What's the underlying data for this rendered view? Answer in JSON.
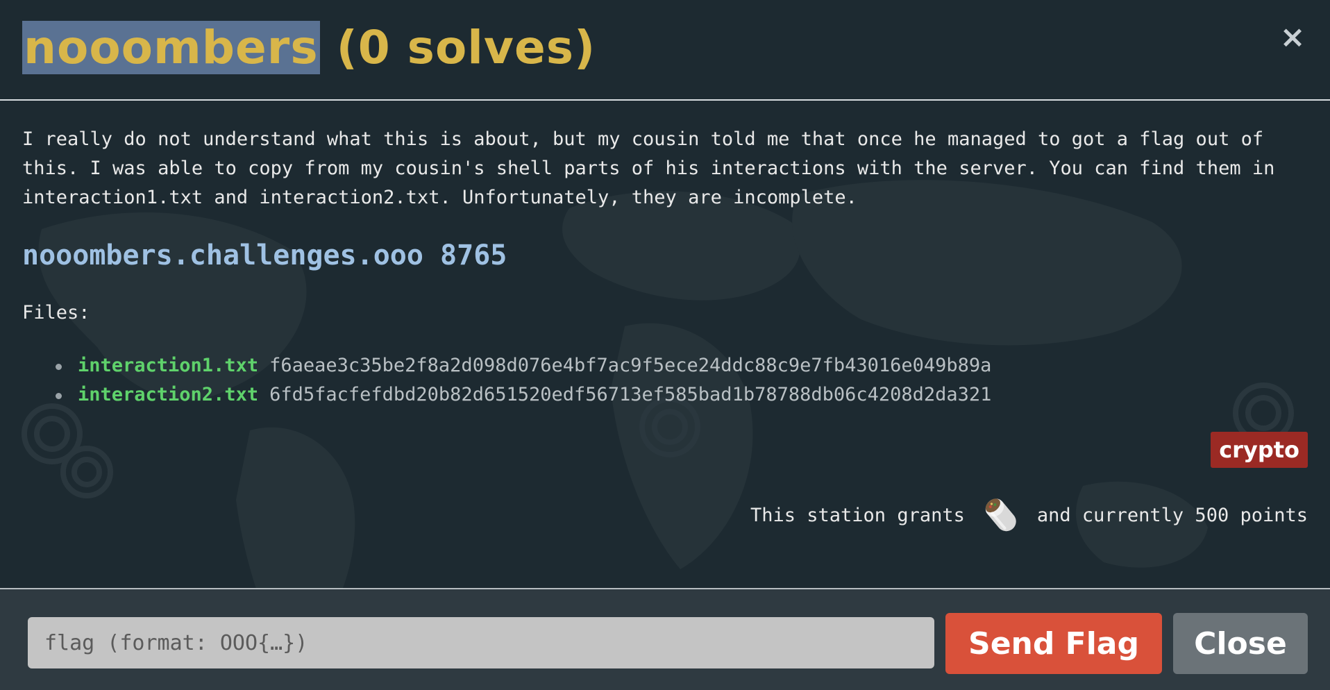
{
  "header": {
    "title_selected": "nooombers",
    "title_rest": " (0 solves)",
    "close_symbol": "×"
  },
  "challenge": {
    "description": "I really do not understand what this is about, but my cousin told me that once he managed to got a flag out of this. I was able to copy from my cousin's shell parts of his interactions with the server. You can find them in interaction1.txt and interaction2.txt. Unfortunately, they are incomplete.",
    "host": "nooombers.challenges.ooo 8765",
    "files_label": "Files:",
    "files": [
      {
        "name": "interaction1.txt",
        "hash": "f6aeae3c35be2f8a2d098d076e4bf7ac9f5ece24ddc88c9e7fb43016e049b89a"
      },
      {
        "name": "interaction2.txt",
        "hash": "6fd5facfefdbd20b82d651520edf56713ef585bad1b78788db06c4208d2da321"
      }
    ],
    "category_tag": "crypto",
    "grant_prefix": "This station grants",
    "grant_suffix": "and currently 500 points",
    "grant_icon": "pill-capsule-icon"
  },
  "footer": {
    "flag_placeholder": "flag (format: OOO{…})",
    "send_label": "Send Flag",
    "close_label": "Close"
  },
  "colors": {
    "title": "#d8b64a",
    "host": "#9fc1e3",
    "file_link": "#5fd26b",
    "tag_bg": "#9b2a24",
    "send_bg": "#d9513a",
    "close_bg": "#6b7378"
  }
}
